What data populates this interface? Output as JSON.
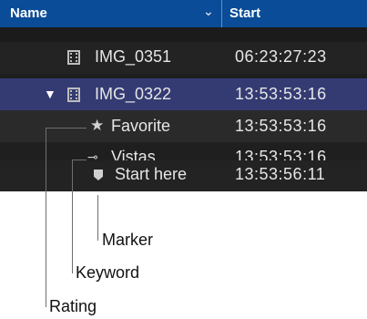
{
  "header": {
    "name_label": "Name",
    "start_label": "Start"
  },
  "rows": [
    {
      "name": "IMG_0351",
      "start": "06:23:27:23"
    },
    {
      "name": "IMG_0322",
      "start": "13:53:53:16"
    },
    {
      "name": "Favorite",
      "start": "13:53:53:16"
    },
    {
      "name": "Vistas",
      "start": "13:53:53:16"
    },
    {
      "name": "Start here",
      "start": "13:53:56:11"
    }
  ],
  "callouts": {
    "marker": "Marker",
    "keyword": "Keyword",
    "rating": "Rating"
  },
  "colors": {
    "header_bg": "#0a4c97",
    "selected_row_bg": "#343b73",
    "list_bg": "#1e1e1e"
  },
  "icons": [
    "chevron-down-icon",
    "filmstrip-icon",
    "disclosure-triangle-icon",
    "star-icon",
    "key-icon",
    "marker-icon"
  ]
}
